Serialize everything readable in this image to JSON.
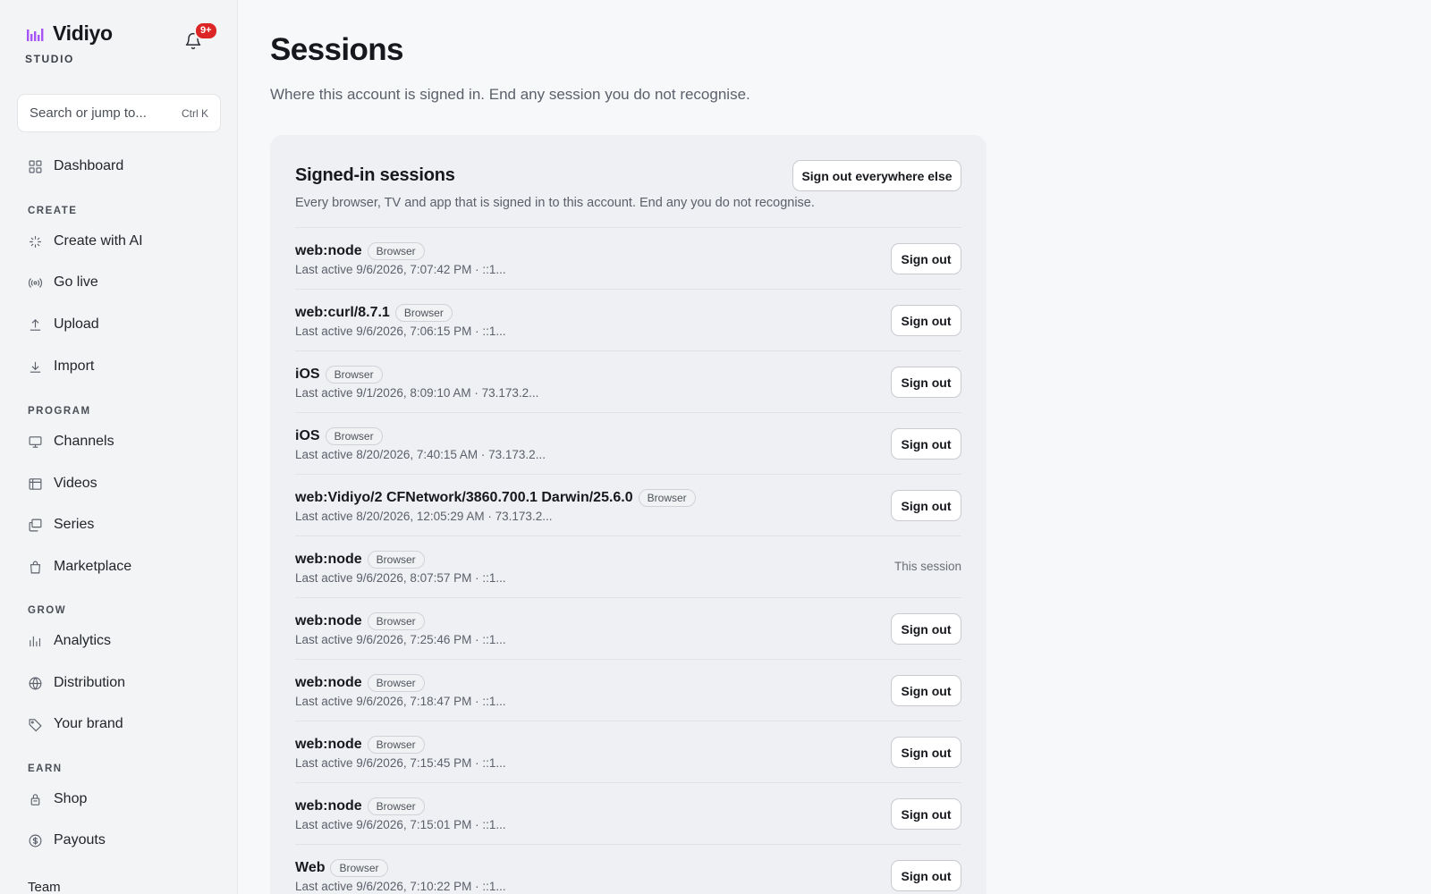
{
  "brand": {
    "name": "Vidiyo",
    "sub": "STUDIO",
    "logo_color": "#a855f7"
  },
  "notifications": {
    "badge": "9+",
    "badge_color": "#dc2626"
  },
  "search": {
    "placeholder": "Search or jump to...",
    "shortcut": "Ctrl K"
  },
  "nav": {
    "dashboard": "Dashboard",
    "sections": [
      "CREATE",
      "PROGRAM",
      "GROW",
      "EARN"
    ],
    "create": [
      "Create with AI",
      "Go live",
      "Upload",
      "Import"
    ],
    "program": [
      "Channels",
      "Videos",
      "Series",
      "Marketplace"
    ],
    "grow": [
      "Analytics",
      "Distribution",
      "Your brand"
    ],
    "earn": [
      "Shop",
      "Payouts"
    ],
    "team": "Team"
  },
  "page": {
    "title": "Sessions",
    "subtitle": "Where this account is signed in. End any session you do not recognise."
  },
  "card": {
    "title": "Signed-in sessions",
    "description": "Every browser, TV and app that is signed in to this account. End any you do not recognise.",
    "sign_out_all": "Sign out everywhere else",
    "sign_out_label": "Sign out",
    "this_session_label": "This session"
  },
  "sessions": [
    {
      "name": "web:node",
      "badge": "Browser",
      "meta": "Last active 9/6/2026, 7:07:42 PM · ::1...",
      "current": false
    },
    {
      "name": "web:curl/8.7.1",
      "badge": "Browser",
      "meta": "Last active 9/6/2026, 7:06:15 PM · ::1...",
      "current": false
    },
    {
      "name": "iOS",
      "badge": "Browser",
      "meta": "Last active 9/1/2026, 8:09:10 AM · 73.173.2...",
      "current": false
    },
    {
      "name": "iOS",
      "badge": "Browser",
      "meta": "Last active 8/20/2026, 7:40:15 AM · 73.173.2...",
      "current": false
    },
    {
      "name": "web:Vidiyo/2 CFNetwork/3860.700.1 Darwin/25.6.0",
      "badge": "Browser",
      "meta": "Last active 8/20/2026, 12:05:29 AM · 73.173.2...",
      "current": false
    },
    {
      "name": "web:node",
      "badge": "Browser",
      "meta": "Last active 9/6/2026, 8:07:57 PM · ::1...",
      "current": true
    },
    {
      "name": "web:node",
      "badge": "Browser",
      "meta": "Last active 9/6/2026, 7:25:46 PM · ::1...",
      "current": false
    },
    {
      "name": "web:node",
      "badge": "Browser",
      "meta": "Last active 9/6/2026, 7:18:47 PM · ::1...",
      "current": false
    },
    {
      "name": "web:node",
      "badge": "Browser",
      "meta": "Last active 9/6/2026, 7:15:45 PM · ::1...",
      "current": false
    },
    {
      "name": "web:node",
      "badge": "Browser",
      "meta": "Last active 9/6/2026, 7:15:01 PM · ::1...",
      "current": false
    },
    {
      "name": "Web",
      "badge": "Browser",
      "meta": "Last active 9/6/2026, 7:10:22 PM · ::1...",
      "current": false
    }
  ]
}
